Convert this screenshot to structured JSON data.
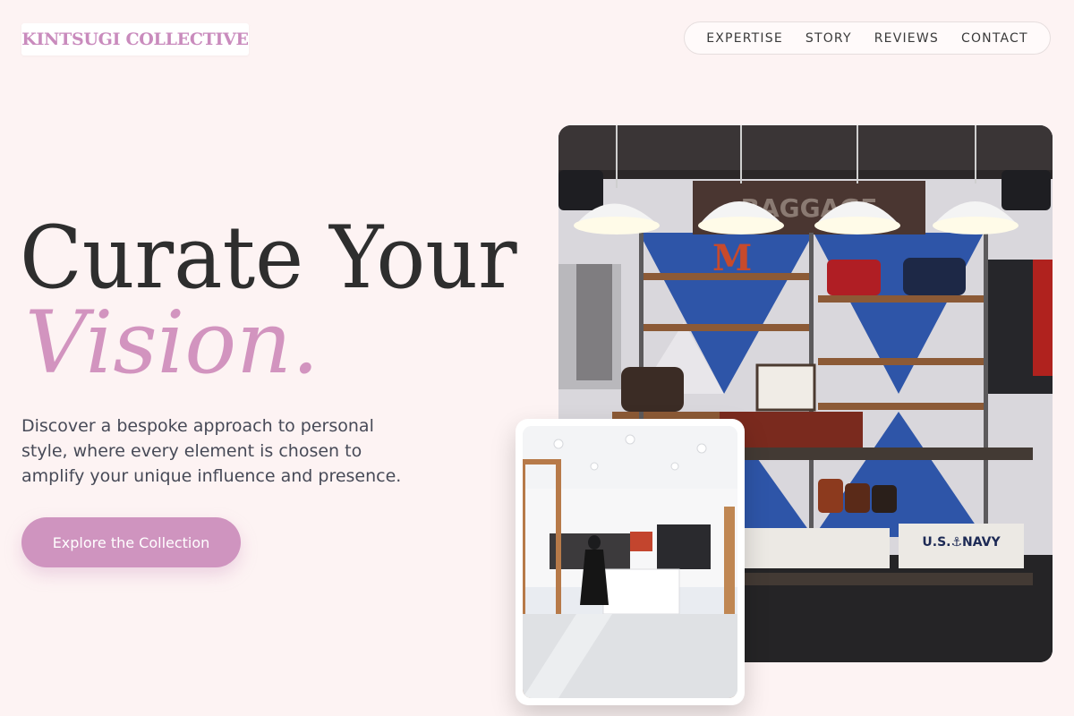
{
  "brand": {
    "name": "KINTSUGI COLLECTIVE"
  },
  "nav": {
    "items": [
      {
        "label": "EXPERTISE"
      },
      {
        "label": "STORY"
      },
      {
        "label": "REVIEWS"
      },
      {
        "label": "CONTACT"
      }
    ]
  },
  "hero": {
    "title_line1": "Curate Your",
    "title_line2": "Vision.",
    "description": "Discover a bespoke approach to personal style, where every element is chosen to amplify your unique influence and presence.",
    "cta_label": "Explore the Collection"
  },
  "images": {
    "main_sign_text": "BAGGAGE",
    "main_letter": "M",
    "main_tshirt_text": "U.S.⚓NAVY"
  },
  "colors": {
    "accent": "#cf94bf",
    "background": "#fdf3f3",
    "heading": "#2e2e2e"
  }
}
